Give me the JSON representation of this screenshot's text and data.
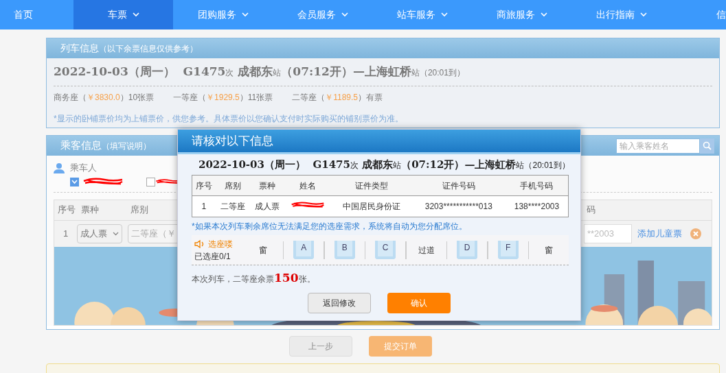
{
  "nav": [
    {
      "label": "首页",
      "dropdown": false,
      "selected": false
    },
    {
      "label": "车票",
      "dropdown": true,
      "selected": true
    },
    {
      "label": "团购服务",
      "dropdown": true,
      "selected": false
    },
    {
      "label": "会员服务",
      "dropdown": true,
      "selected": false
    },
    {
      "label": "站车服务",
      "dropdown": true,
      "selected": false
    },
    {
      "label": "商旅服务",
      "dropdown": true,
      "selected": false
    },
    {
      "label": "出行指南",
      "dropdown": true,
      "selected": false
    },
    {
      "label": "信",
      "dropdown": false,
      "selected": false
    }
  ],
  "train_panel": {
    "title": "列车信息",
    "subtitle": "（以下余票信息仅供参考）",
    "trip": [
      {
        "text": "2022-10-03（周一）  G1475",
        "kind": "big"
      },
      {
        "text": "次",
        "kind": "small"
      },
      {
        "text": " 成都东",
        "kind": "big"
      },
      {
        "text": "站",
        "kind": "small"
      },
      {
        "text": "（07:12开）—上海虹桥",
        "kind": "big"
      },
      {
        "text": "站（20:01到）",
        "kind": "small"
      }
    ],
    "seats": [
      [
        {
          "text": "商务座（"
        },
        {
          "text": "￥3830.0",
          "kind": "price"
        },
        {
          "text": "）10张票"
        }
      ],
      [
        {
          "text": "一等座（"
        },
        {
          "text": "￥1929.5",
          "kind": "price"
        },
        {
          "text": "）11张票"
        }
      ],
      [
        {
          "text": "二等座（"
        },
        {
          "text": "￥1189.5",
          "kind": "price"
        },
        {
          "text": "）有票"
        }
      ]
    ],
    "note": "*显示的卧铺票价均为上铺票价，供您参考。具体票价以您确认支付时实际购买的铺别票价为准。"
  },
  "passenger_panel": {
    "title": "乘客信息",
    "subtitle": "（填写说明）",
    "search": {
      "placeholder": "输入乘客姓名"
    },
    "section_label": "乘车人",
    "passengers": [
      {
        "checked": true,
        "redacted": true
      },
      {
        "checked": false,
        "redacted": true
      }
    ],
    "columns_left": [
      "序号",
      "票种",
      "席别"
    ],
    "column_right": "码",
    "row": {
      "seq": "1",
      "ticket_type": "成人票",
      "seat_class": "二等座（￥",
      "phone": "**2003",
      "add_child": "添加儿童票"
    }
  },
  "actions": [
    {
      "label": "上一步",
      "kind": "secondary"
    },
    {
      "label": "提交订单",
      "kind": "primary"
    }
  ],
  "dialog": {
    "title": "请核对以下信息",
    "trip": [
      {
        "text": "2022-10-03（周一）  G1475",
        "kind": "big"
      },
      {
        "text": "次",
        "kind": "small"
      },
      {
        "text": " 成都东",
        "kind": "big"
      },
      {
        "text": "站",
        "kind": "small"
      },
      {
        "text": "（07:12开）—上海虹桥",
        "kind": "big"
      },
      {
        "text": "站（20:01到）",
        "kind": "small"
      }
    ],
    "columns": [
      "序号",
      "席别",
      "票种",
      "姓名",
      "证件类型",
      "证件号码",
      "手机号码"
    ],
    "rows": [
      {
        "seq": "1",
        "seat_class": "二等座",
        "ticket_type": "成人票",
        "name_redacted": true,
        "id_type": "中国居民身份证",
        "id_no": "3203***********013",
        "phone": "138****2003"
      }
    ],
    "notice": "*如果本次列车剩余席位无法满足您的选座需求，系统将自动为您分配席位。",
    "seat_picker": {
      "title": "选座喽",
      "status": "已选座0/1",
      "items": [
        {
          "kind": "label",
          "text": "窗"
        },
        {
          "kind": "divider"
        },
        {
          "kind": "seat",
          "text": "A",
          "selected": false
        },
        {
          "kind": "divider"
        },
        {
          "kind": "seat",
          "text": "B",
          "selected": false
        },
        {
          "kind": "divider"
        },
        {
          "kind": "seat",
          "text": "C",
          "selected": false
        },
        {
          "kind": "divider"
        },
        {
          "kind": "label",
          "text": "过道"
        },
        {
          "kind": "divider"
        },
        {
          "kind": "seat",
          "text": "D",
          "selected": false
        },
        {
          "kind": "divider"
        },
        {
          "kind": "seat",
          "text": "F",
          "selected": false
        },
        {
          "kind": "divider"
        },
        {
          "kind": "label",
          "text": "窗"
        }
      ]
    },
    "remaining": "本次列车，二等座余票**150**张。",
    "buttons": [
      {
        "label": "返回修改",
        "kind": "secondary"
      },
      {
        "label": "确认",
        "kind": "primary"
      }
    ]
  }
}
